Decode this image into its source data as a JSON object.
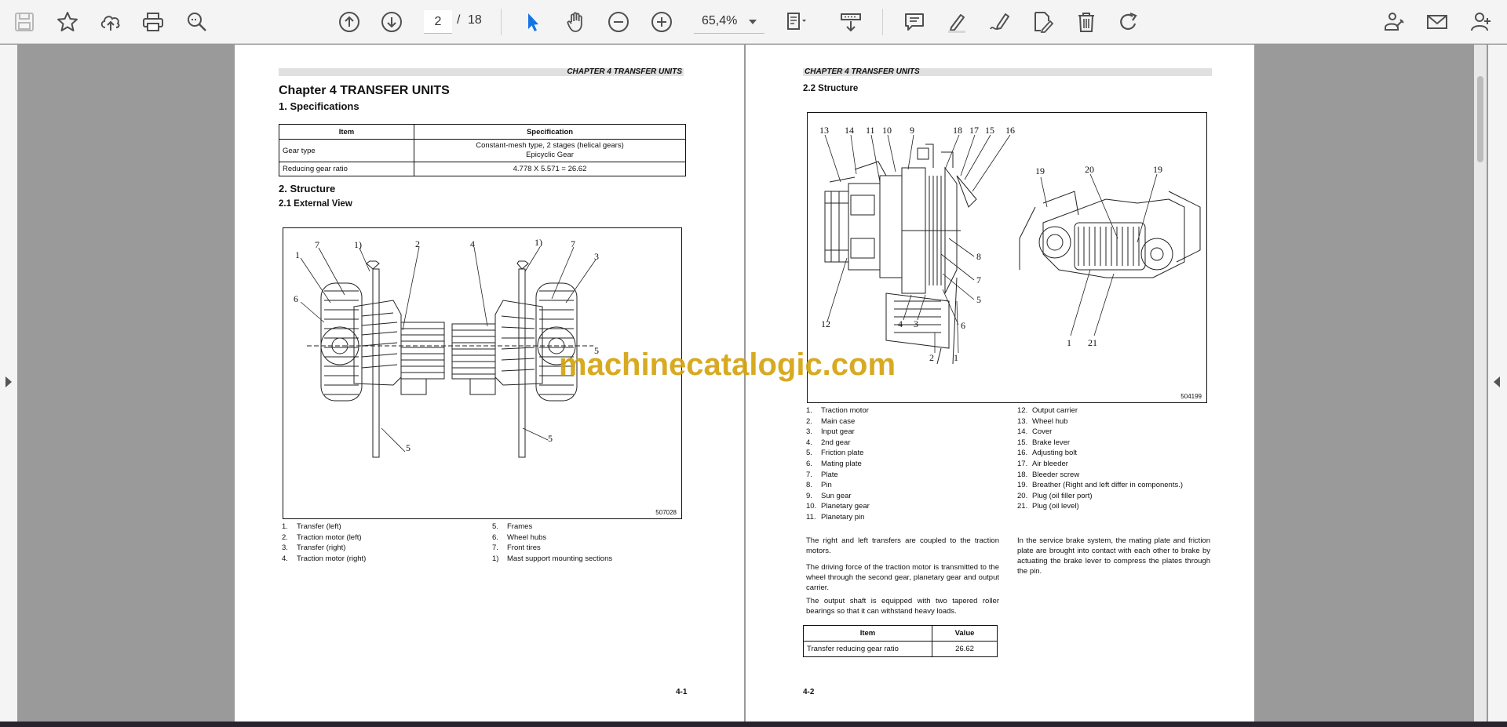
{
  "toolbar": {
    "page_current": "2",
    "page_separator": "/",
    "page_total": "18",
    "zoom": "65,4%",
    "icons": [
      "save-icon",
      "star-icon",
      "upload-cloud-icon",
      "print-icon",
      "zoom-search-icon",
      "page-up-icon",
      "page-down-icon",
      "select-cursor-icon",
      "hand-tool-icon",
      "zoom-out-icon",
      "zoom-in-icon",
      "fit-page-icon",
      "scroll-mode-icon",
      "comment-icon",
      "highlight-icon",
      "sign-icon",
      "edit-pdf-icon",
      "delete-icon",
      "rotate-icon",
      "share-link-icon",
      "email-icon",
      "add-user-icon"
    ],
    "accent_color": "#1473e6"
  },
  "watermark": "machinecatalogic.com",
  "left_page": {
    "running_head": "CHAPTER 4 TRANSFER UNITS",
    "chapter_title": "Chapter 4    TRANSFER UNITS",
    "section1": "1.     Specifications",
    "spec_table": {
      "headers": [
        "Item",
        "Specification"
      ],
      "rows": [
        [
          "Gear type",
          "Constant-mesh type, 2 stages (helical gears)",
          "Epicyclic Gear"
        ],
        [
          "Reducing gear ratio",
          "4.778 X 5.571 = 26.62",
          ""
        ]
      ]
    },
    "section2": "2.     Structure",
    "section21": "2.1      External View",
    "figure_id": "507028",
    "callouts": [
      "1",
      "7",
      "1)",
      "2",
      "6",
      "5",
      "4",
      "1)",
      "7",
      "3",
      "5",
      "5"
    ],
    "legend_left": [
      {
        "n": "1.",
        "t": "Transfer (left)"
      },
      {
        "n": "2.",
        "t": "Traction motor (left)"
      },
      {
        "n": "3.",
        "t": "Transfer (right)"
      },
      {
        "n": "4.",
        "t": "Traction motor (right)"
      }
    ],
    "legend_right": [
      {
        "n": "5.",
        "t": "Frames"
      },
      {
        "n": "6.",
        "t": "Wheel hubs"
      },
      {
        "n": "7.",
        "t": "Front tires"
      },
      {
        "n": "1)",
        "t": "Mast support mounting sections"
      }
    ],
    "page_number": "4-1"
  },
  "right_page": {
    "running_head": "CHAPTER 4 TRANSFER UNITS",
    "section22": "2.2      Structure",
    "figure_id": "504199",
    "callouts": [
      "13",
      "14",
      "11",
      "10",
      "9",
      "18",
      "17",
      "15",
      "16",
      "19",
      "20",
      "19",
      "8",
      "7",
      "5",
      "6",
      "12",
      "4",
      "3",
      "2",
      "1",
      "1",
      "21"
    ],
    "legend_left": [
      {
        "n": "1.",
        "t": "Traction motor"
      },
      {
        "n": "2.",
        "t": "Main case"
      },
      {
        "n": "3.",
        "t": "Input gear"
      },
      {
        "n": "4.",
        "t": "2nd gear"
      },
      {
        "n": "5.",
        "t": "Friction plate"
      },
      {
        "n": "6.",
        "t": "Mating plate"
      },
      {
        "n": "7.",
        "t": "Plate"
      },
      {
        "n": "8.",
        "t": "Pin"
      },
      {
        "n": "9.",
        "t": "Sun gear"
      },
      {
        "n": "10.",
        "t": "Planetary gear"
      },
      {
        "n": "11.",
        "t": "Planetary pin"
      }
    ],
    "legend_right": [
      {
        "n": "12.",
        "t": "Output carrier"
      },
      {
        "n": "13.",
        "t": "Wheel hub"
      },
      {
        "n": "14.",
        "t": "Cover"
      },
      {
        "n": "15.",
        "t": "Brake lever"
      },
      {
        "n": "16.",
        "t": "Adjusting bolt"
      },
      {
        "n": "17.",
        "t": "Air bleeder"
      },
      {
        "n": "18.",
        "t": "Bleeder screw"
      },
      {
        "n": "19.",
        "t": "Breather (Right and left differ in components.)"
      },
      {
        "n": "20.",
        "t": "Plug (oil filler port)"
      },
      {
        "n": "21.",
        "t": "Plug (oil level)"
      }
    ],
    "para1": "The right and left transfers are coupled to the traction motors.",
    "para2": "The driving force of the traction motor is transmitted to the wheel through the second gear, planetary gear and output carrier.",
    "para3": "The output shaft is equipped with two tapered roller bearings so that it can withstand heavy loads.",
    "para4": "In the service brake system, the mating plate and friction plate are brought into contact with each other to brake by actuating the brake lever to compress the plates through the pin.",
    "value_table": {
      "headers": [
        "Item",
        "Value"
      ],
      "rows": [
        [
          "Transfer reducing gear ratio",
          "26.62"
        ]
      ]
    },
    "page_number": "4-2"
  }
}
